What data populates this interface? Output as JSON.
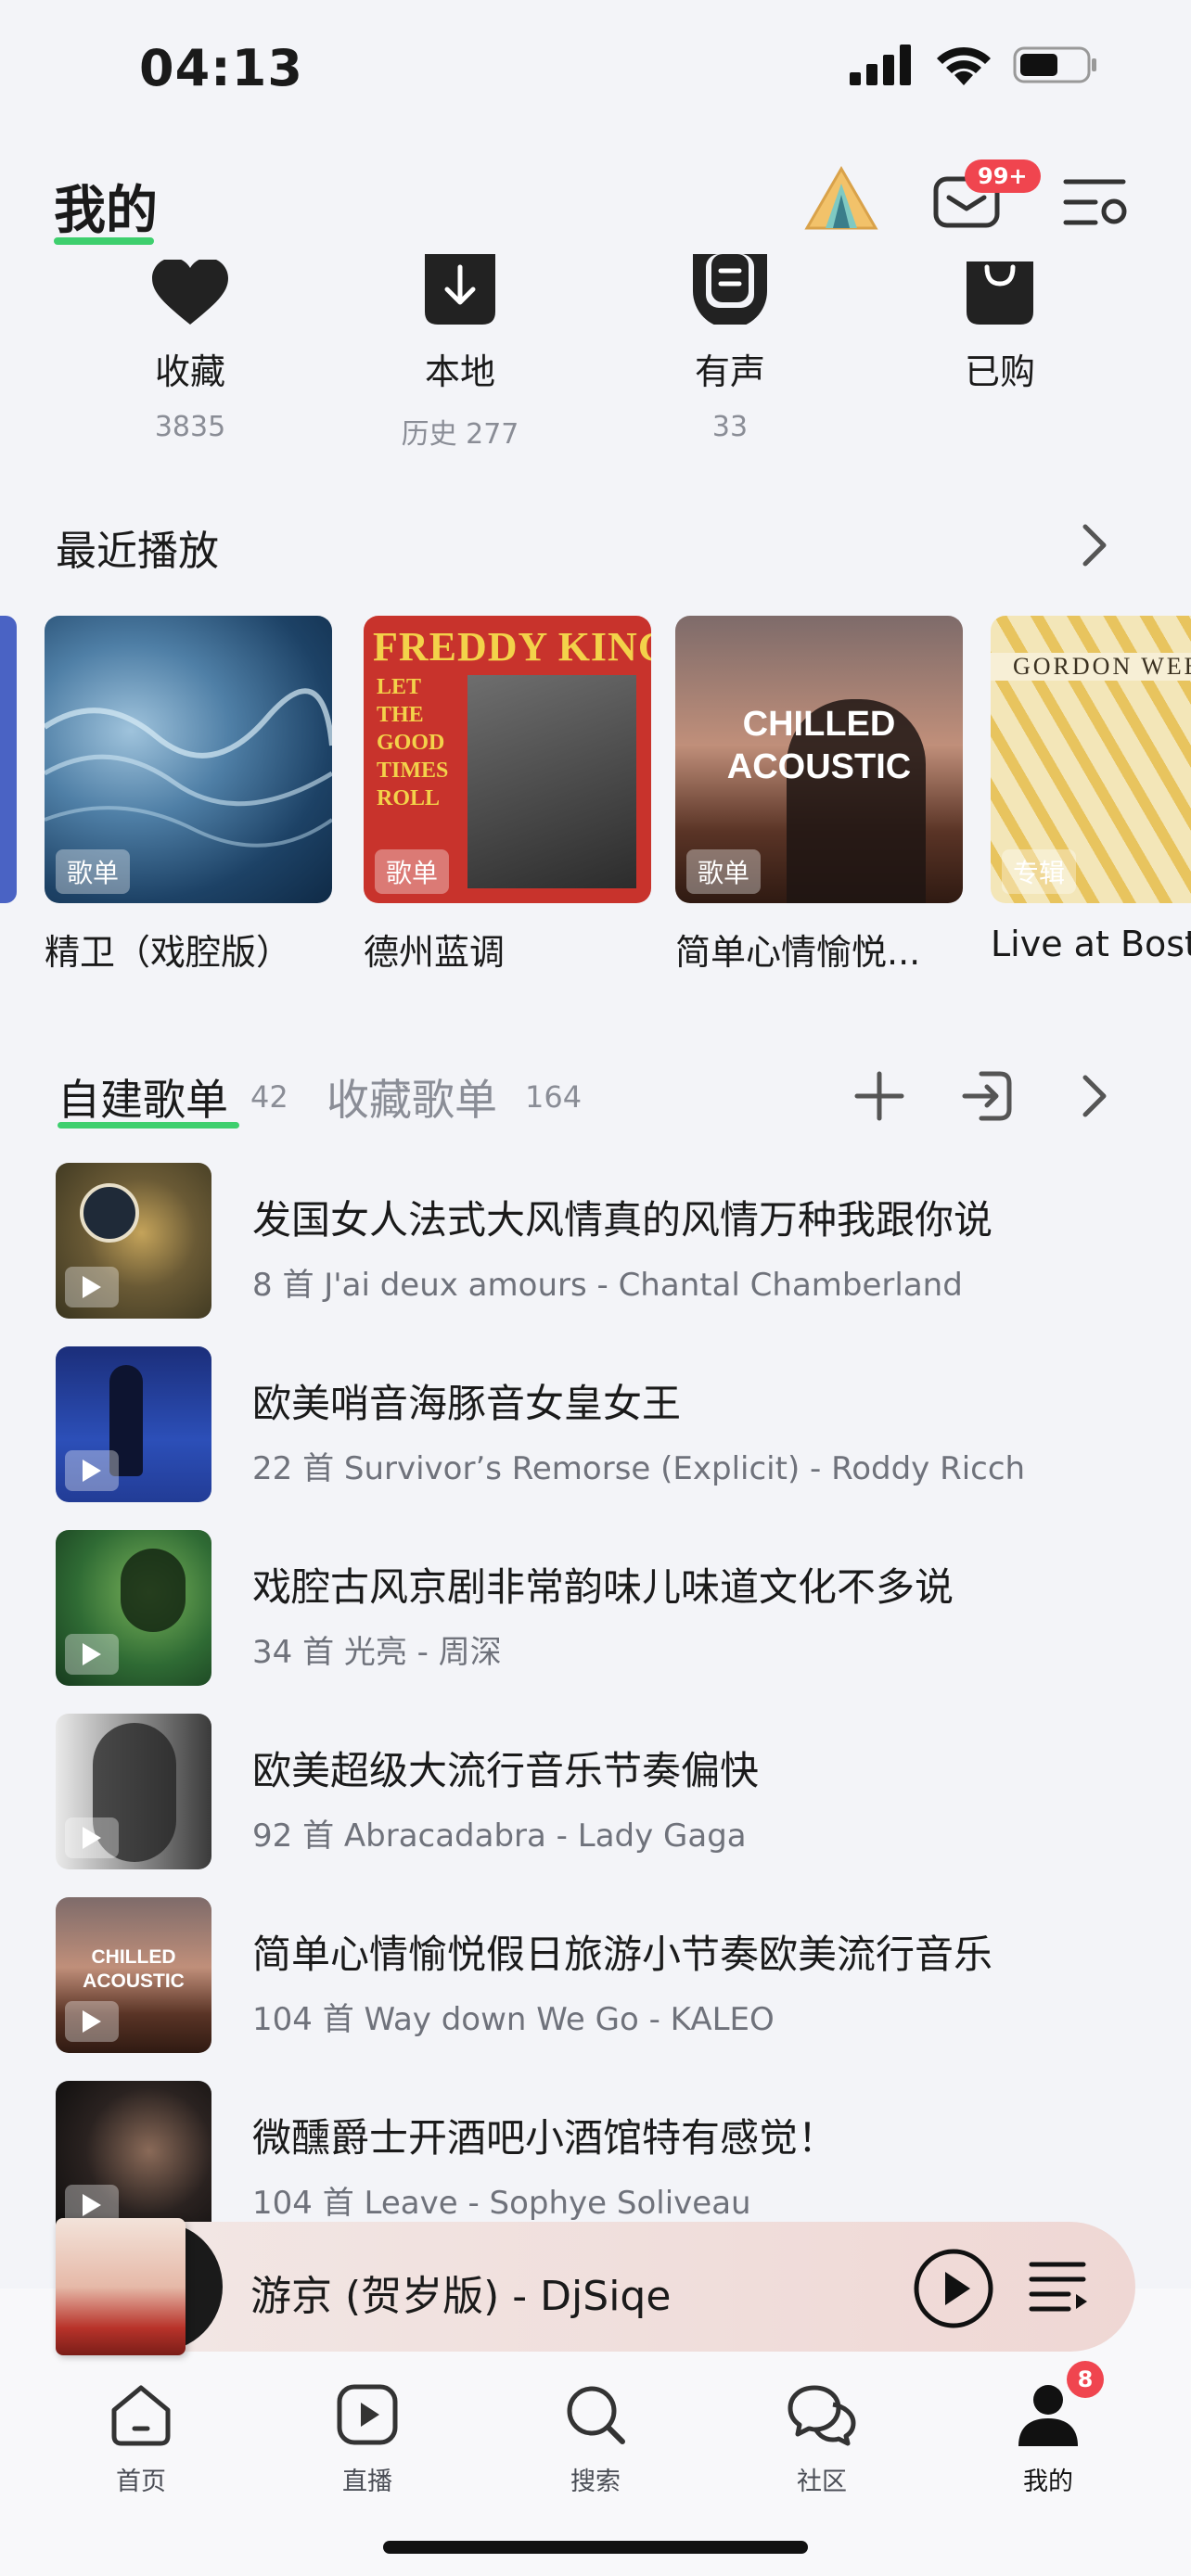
{
  "status": {
    "time": "04:13"
  },
  "header": {
    "title": "我的",
    "mail_badge": "99+"
  },
  "quick_actions": [
    {
      "icon": "heart-icon",
      "label": "收藏",
      "sub": "3835"
    },
    {
      "icon": "download-icon",
      "label": "本地",
      "sub": "历史 277"
    },
    {
      "icon": "audiobook-icon",
      "label": "有声",
      "sub": "33"
    },
    {
      "icon": "bag-icon",
      "label": "已购",
      "sub": ""
    }
  ],
  "recent": {
    "title": "最近播放",
    "items": [
      {
        "name": "精卫（戏腔版）",
        "tag": "歌单"
      },
      {
        "name": "德州蓝调",
        "tag": "歌单",
        "cover_text": "FREDDY KING",
        "cover_text2": "LET THE GOOD TIMES ROLL"
      },
      {
        "name": "简单心情愉悦...",
        "tag": "歌单",
        "cover_text": "CHILLED ACOUSTIC"
      },
      {
        "name": "Live at Bost",
        "tag": "专辑",
        "cover_text": "GORDON WEB"
      }
    ]
  },
  "playlist_tabs": {
    "created_label": "自建歌单",
    "created_count": "42",
    "collected_label": "收藏歌单",
    "collected_count": "164"
  },
  "playlists": [
    {
      "title": "发国女人法式大风情真的风情万种我跟你说",
      "subtitle": "8 首 J'ai deux amours - Chantal Chamberland",
      "cover_color": "#5a4a2c"
    },
    {
      "title": "欧美哨音海豚音女皇女王",
      "subtitle": "22 首 Survivor’s Remorse (Explicit) - Roddy Ricch",
      "cover_color": "#1f3f9a"
    },
    {
      "title": "戏腔古风京剧非常韵味儿味道文化不多说",
      "subtitle": "34 首 光亮 - 周深",
      "cover_color": "#2e6b3a"
    },
    {
      "title": "欧美超级大流行音乐节奏偏快",
      "subtitle": "92 首 Abracadabra - Lady Gaga",
      "cover_color": "#777777"
    },
    {
      "title": "简单心情愉悦假日旅游小节奏欧美流行音乐",
      "subtitle": "104 首 Way down We Go - KALEO",
      "cover_color": "#8a4a3a",
      "cover_text": "CHILLED ACOUSTIC"
    },
    {
      "title": "微醺爵士开酒吧小酒馆特有感觉！",
      "subtitle": "104 首 Leave - Sophye Soliveau",
      "cover_color": "#2a2a2a"
    }
  ],
  "mini_player": {
    "title": "游京 (贺岁版) - DjSiqe"
  },
  "tabbar": {
    "items": [
      {
        "label": "首页",
        "icon": "home-icon"
      },
      {
        "label": "直播",
        "icon": "live-icon"
      },
      {
        "label": "搜索",
        "icon": "search-icon"
      },
      {
        "label": "社区",
        "icon": "community-icon"
      },
      {
        "label": "我的",
        "icon": "profile-icon"
      }
    ],
    "profile_badge": "8"
  }
}
